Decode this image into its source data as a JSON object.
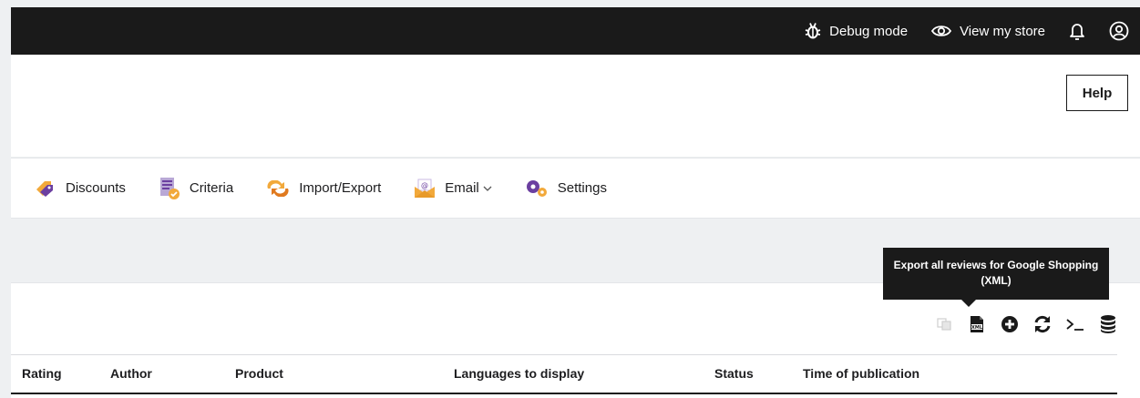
{
  "topbar": {
    "debug_label": "Debug mode",
    "view_store_label": "View my store",
    "icons": [
      "bug-icon",
      "eye-icon",
      "bell-icon",
      "user-icon"
    ]
  },
  "header": {
    "help_label": "Help"
  },
  "nav": {
    "items": [
      {
        "label": "Discounts",
        "icon": "discount-tag-icon"
      },
      {
        "label": "Criteria",
        "icon": "criteria-checklist-icon"
      },
      {
        "label": "Import/Export",
        "icon": "import-export-arrows-icon"
      },
      {
        "label": "Email",
        "icon": "email-envelope-icon",
        "has_dropdown": true
      },
      {
        "label": "Settings",
        "icon": "settings-gears-icon"
      }
    ]
  },
  "toolbar": {
    "tooltip": "Export all reviews for Google Shopping (XML)",
    "icons": [
      "translate-icon",
      "xml-export-icon",
      "add-circle-icon",
      "refresh-icon",
      "terminal-icon",
      "database-icon"
    ]
  },
  "table": {
    "columns": [
      "Rating",
      "Author",
      "Product",
      "Languages to display",
      "Status",
      "Time of publication"
    ]
  },
  "colors": {
    "topbar_bg": "#1a1a1a",
    "page_bg": "#eef0f2",
    "accent_purple": "#6b3fa0",
    "accent_orange": "#f2a93b"
  }
}
